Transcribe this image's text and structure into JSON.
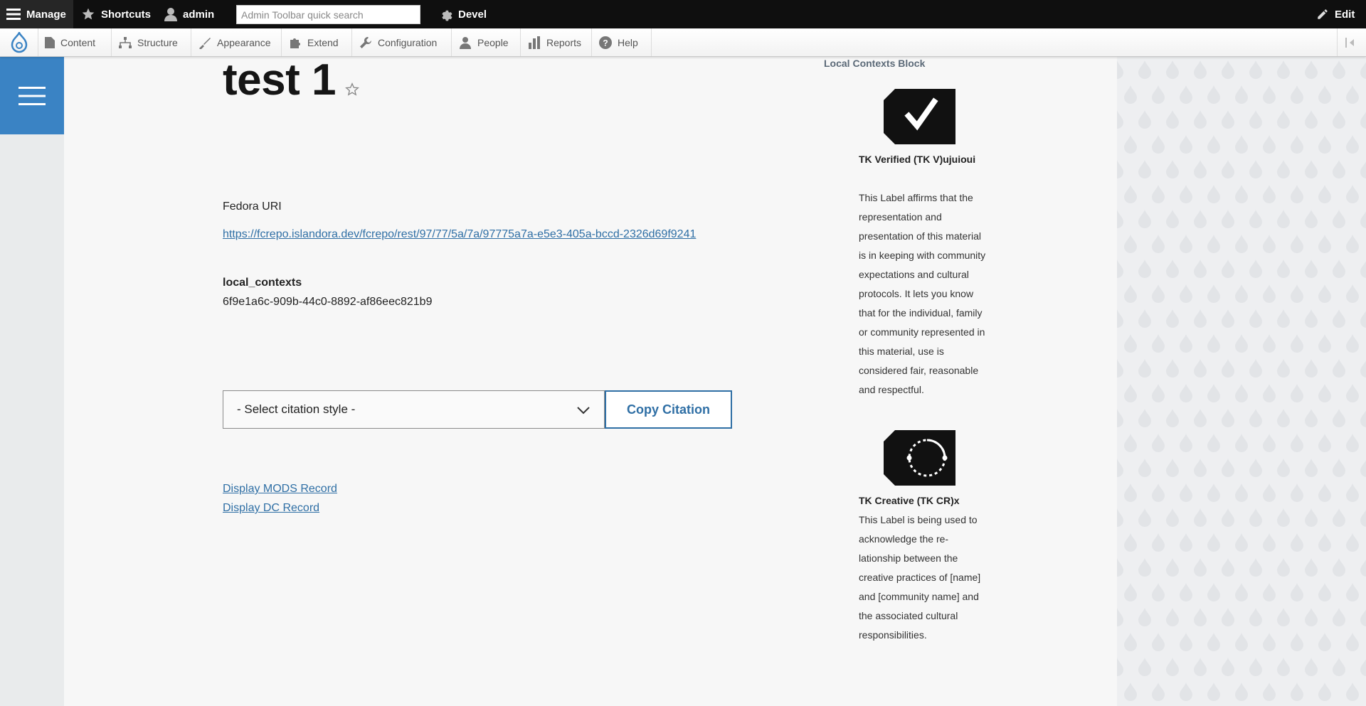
{
  "toolbar": {
    "manage": "Manage",
    "shortcuts": "Shortcuts",
    "user": "admin",
    "search_placeholder": "Admin Toolbar quick search",
    "devel": "Devel",
    "edit": "Edit"
  },
  "tray": {
    "items": [
      "Content",
      "Structure",
      "Appearance",
      "Extend",
      "Configuration",
      "People",
      "Reports",
      "Help"
    ]
  },
  "page": {
    "title": "test 1",
    "fedora_label": "Fedora URI",
    "fedora_url": "https://fcrepo.islandora.dev/fcrepo/rest/97/77/5a/7a/97775a7a-e5e3-405a-bccd-2326d69f9241",
    "local_contexts_label": "local_contexts",
    "local_contexts_value": "6f9e1a6c-909b-44c0-8892-af86eec821b9",
    "citation_select": "- Select citation style -",
    "copy_citation": "Copy Citation",
    "mods_link": "Display MODS Record",
    "dc_link": "Display DC Record"
  },
  "sidebar": {
    "heading": "Local Contexts Block",
    "labels": [
      {
        "name": "TK Verified (TK V)ujuioui",
        "icon": "tk-verified-check-icon",
        "description": "This Label affirms that the representation and presentation of this ma­terial is in keeping with community expectations and cultural protocols. It lets you know that for the individual, family or community represented in this material, use is considered fair, reason­able and respectful."
      },
      {
        "name": "TK Creative (TK CR)x",
        "icon": "tk-creative-circle-icon",
        "description": "This Label is being used to acknowledge the re­lationship between the creative practices of [name] and [community name] and the associat­ed cultural responsibilities."
      }
    ]
  },
  "colors": {
    "toolbar_bg": "#0f0f0f",
    "accent_blue": "#3a83c4",
    "link_blue": "#2f6fa5"
  }
}
